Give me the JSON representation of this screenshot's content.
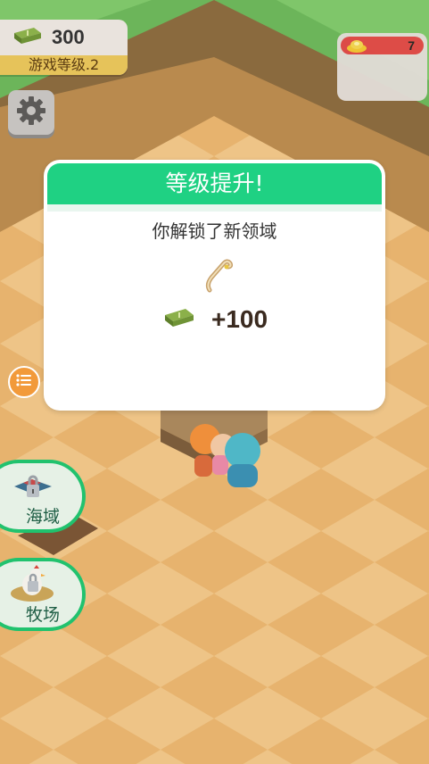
{
  "hud": {
    "money": "300",
    "level_label": "游戏等级.2",
    "chest_count": "7",
    "colors": {
      "money_icon": "#6b8f2b",
      "level_strip": "#e6c35a",
      "chest_bar": "#e34646"
    }
  },
  "dialog": {
    "title": "等级提升!",
    "subtitle": "你解锁了新领域",
    "reward_amount": "+100",
    "unlock_icon": "hook-icon",
    "accent": "#1fd183"
  },
  "side_menu": [
    {
      "label": "海域",
      "icon": "sea-lock-icon"
    },
    {
      "label": "牧场",
      "icon": "ranch-chicken-icon"
    }
  ]
}
